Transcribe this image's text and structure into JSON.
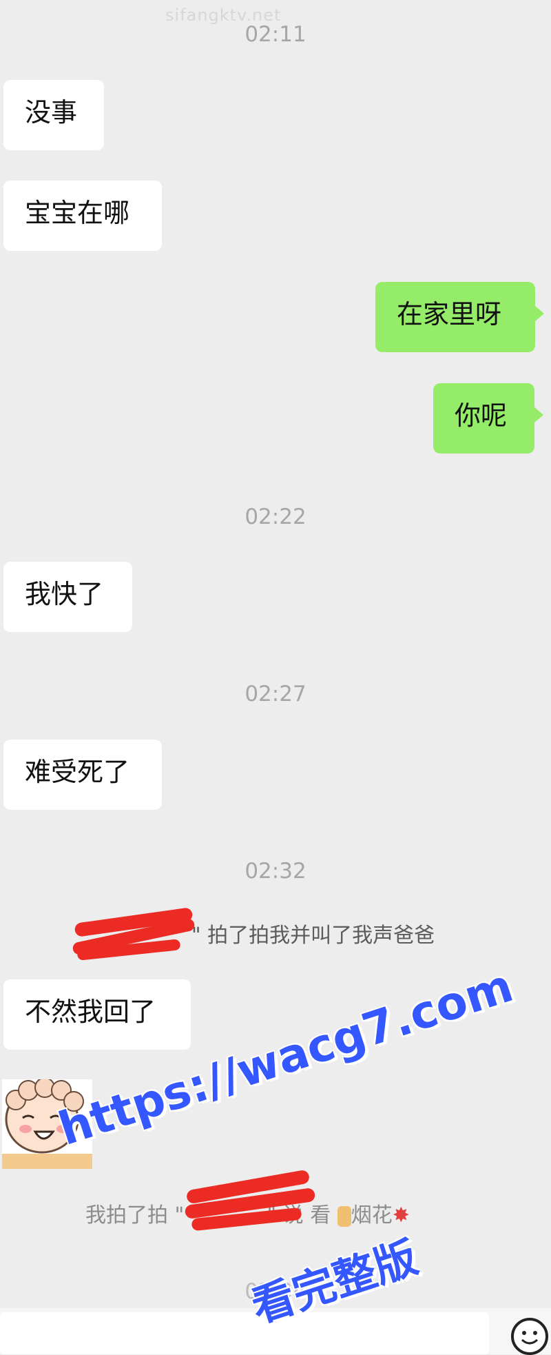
{
  "watermark_top": "sifangktv.net",
  "timestamps": [
    "02:11",
    "02:22",
    "02:27",
    "02:32",
    "02:34"
  ],
  "messages": [
    {
      "side": "in",
      "text": "没事"
    },
    {
      "side": "in",
      "text": "宝宝在哪"
    },
    {
      "side": "out",
      "text": "在家里呀"
    },
    {
      "side": "out",
      "text": "你呢"
    },
    {
      "side": "in",
      "text": "我快了"
    },
    {
      "side": "in",
      "text": "难受死了"
    },
    {
      "side": "in",
      "text": "不然我回了"
    }
  ],
  "system": {
    "pat1_text": "\"——\" 拍了拍我并叫了我声爸爸",
    "pat1_prefix": "\"",
    "pat1_suffix": "\" 拍了拍我并叫了我声爸爸",
    "pat2_prefix": "我拍了拍 \"",
    "pat2_suffix": "\" 说 看 ",
    "pat2_word": "烟花"
  },
  "promo": {
    "url": "https://wacg7.com",
    "label": "看完整版"
  },
  "colors": {
    "background": "#ededed",
    "outgoing_bubble": "#95ec69",
    "incoming_bubble": "#ffffff",
    "promo_blue": "#3457ff",
    "redaction_red": "#ec2b24"
  },
  "icons": {
    "emoji_button": "smiley-icon",
    "sticker": "cartoon-face-sticker",
    "firework": "firework-emoji",
    "hand": "hand-emoji"
  }
}
